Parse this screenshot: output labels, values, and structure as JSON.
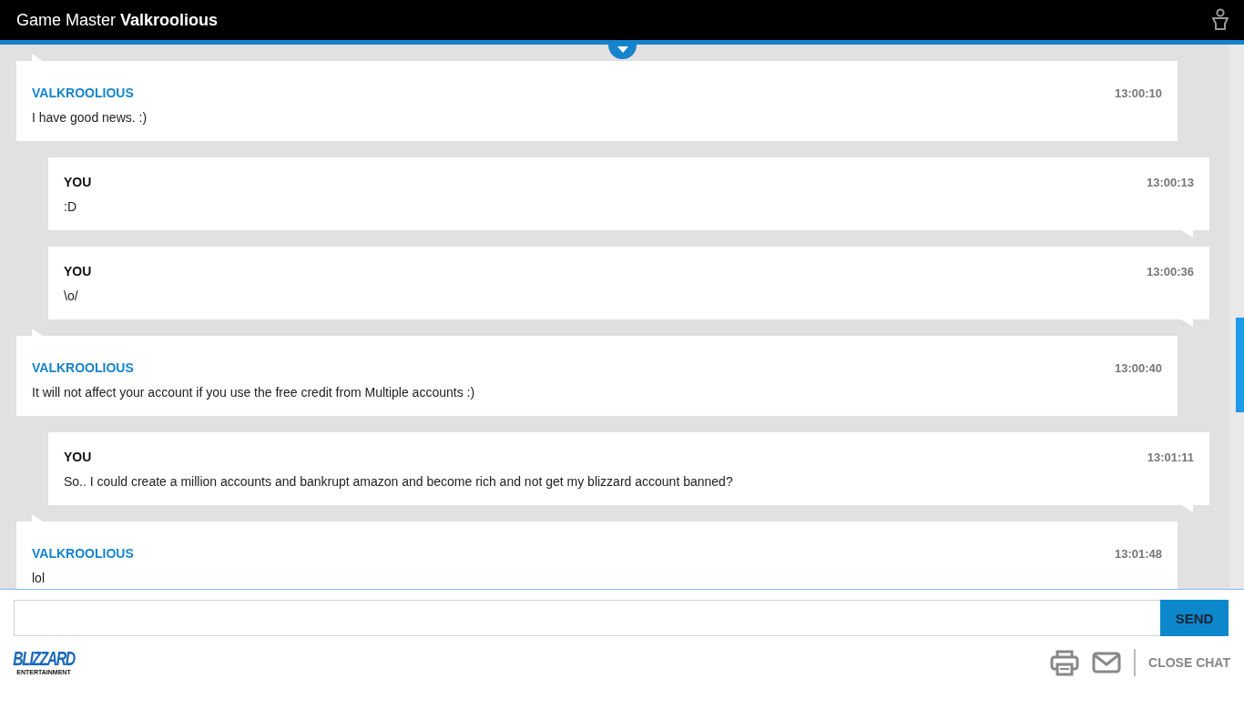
{
  "window": {
    "title": "Game Master **Valkroolious**"
  },
  "messages": [
    {
      "kind": "agent",
      "sender": "VALKROOLIOUS",
      "time": "13:00:10",
      "text": "I have good news. :)"
    },
    {
      "kind": "user",
      "sender": "YOU",
      "time": "13:00:13",
      "text": ":D"
    },
    {
      "kind": "user",
      "sender": "YOU",
      "time": "13:00:36",
      "text": "\\o/"
    },
    {
      "kind": "agent",
      "sender": "VALKROOLIOUS",
      "time": "13:00:40",
      "text": "It will not affect your account if you use the free credit from Multiple accounts :)"
    },
    {
      "kind": "user",
      "sender": "YOU",
      "time": "13:01:11",
      "text": "So.. I could create a million accounts and bankrupt amazon and become rich and not get my blizzard account banned?"
    },
    {
      "kind": "agent",
      "sender": "VALKROOLIOUS",
      "time": "13:01:48",
      "text": "lol"
    }
  ],
  "composer": {
    "send_label": "SEND"
  },
  "footer": {
    "logo": "BLIZZARD",
    "logo_tagline": "ENTERTAINMENT",
    "close_label": "CLOSE CHAT"
  }
}
